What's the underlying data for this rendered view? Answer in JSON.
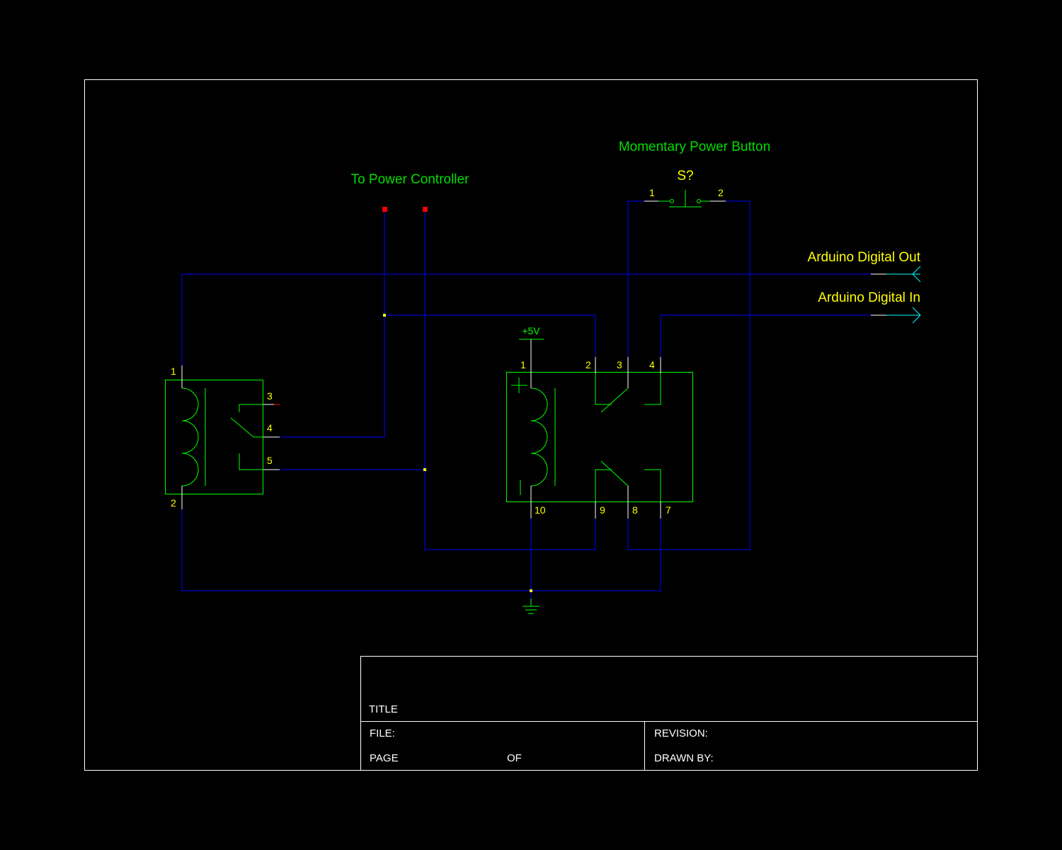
{
  "colors": {
    "background": "#000000",
    "frame": "#ffffff",
    "wire": "#0000ff",
    "component": "#00ff00",
    "label": "#ffff00",
    "annotation": "#00dd00",
    "port": "#00ffff",
    "terminal": "#ff0000",
    "junction": "#ffff00"
  },
  "annotations": {
    "power_controller": "To Power Controller",
    "power_button": "Momentary Power Button"
  },
  "components": {
    "switch": {
      "ref": "S?",
      "pin1": "1",
      "pin2": "2"
    },
    "power": {
      "label": "+5V"
    },
    "relay_left": {
      "pin1": "1",
      "pin2": "2",
      "pin3": "3",
      "pin4": "4",
      "pin5": "5"
    },
    "relay_right": {
      "pin1": "1",
      "pin2": "2",
      "pin3": "3",
      "pin4": "4",
      "pin10": "10",
      "pin9": "9",
      "pin8": "8",
      "pin7": "7"
    }
  },
  "ports": {
    "digital_out": "Arduino Digital Out",
    "digital_in": "Arduino Digital In"
  },
  "title_block": {
    "title": "TITLE",
    "file": "FILE:",
    "revision": "REVISION:",
    "page": "PAGE",
    "of": "OF",
    "drawn_by": "DRAWN BY:"
  }
}
